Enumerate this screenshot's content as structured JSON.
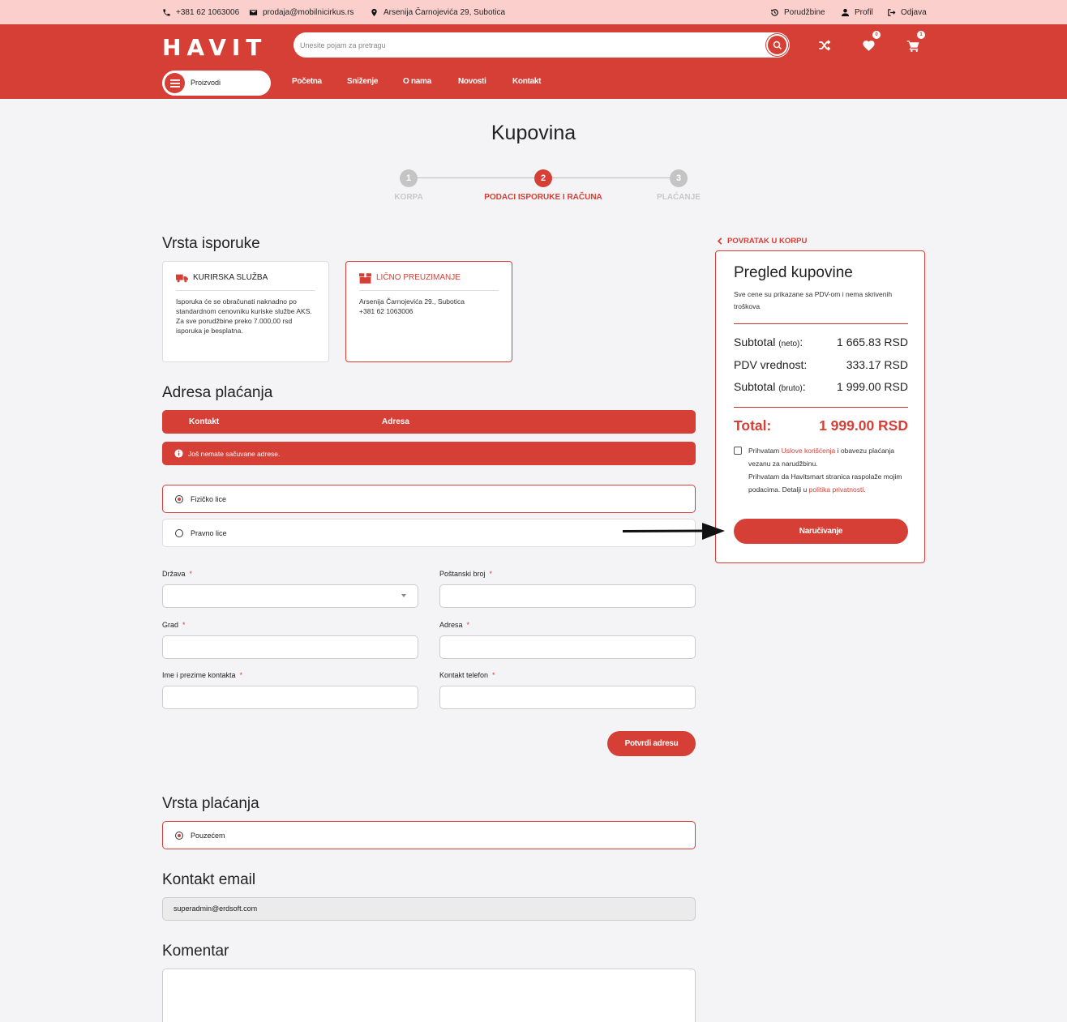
{
  "topbar": {
    "phone": "+381 62 1063006",
    "email": "prodaja@mobilnicirkus.rs",
    "address": "Arsenija Čarnojevića 29, Subotica",
    "orders": "Porudžbine",
    "profile": "Profil",
    "logout": "Odjava"
  },
  "header": {
    "logo": "HAVIT",
    "search_placeholder": "Unesite pojam za pretragu",
    "wishlist_count": "0",
    "cart_count": "1",
    "menu_button": "Proizvodi",
    "nav": [
      "Početna",
      "Sniženje",
      "O nama",
      "Novosti",
      "Kontakt"
    ]
  },
  "page": {
    "title": "Kupovina",
    "steps": [
      {
        "num": "1",
        "label": "KORPA"
      },
      {
        "num": "2",
        "label": "PODACI ISPORUKE I RAČUNA"
      },
      {
        "num": "3",
        "label": "PLAĆANJE"
      }
    ]
  },
  "delivery": {
    "title": "Vrsta isporuke",
    "courier": {
      "title": "KURIRSKA SLUŽBA",
      "text": "Isporuka će se obračunati naknadno po standardnom cenovniku kuriske službe AKS.\nZa sve porudžbine preko 7.000,00 rsd isporuka je besplatna."
    },
    "pickup": {
      "title": "LIČNO PREUZIMANJE",
      "text": "Arsenija Čarnojevića 29., Subotica\n+381 62 1063006"
    }
  },
  "billing": {
    "title": "Adresa plaćanja",
    "tabs": [
      "Kontakt",
      "Adresa"
    ],
    "alert": "Još nemate sačuvane adrese.",
    "person_types": [
      "Fizičko lice",
      "Pravno lice"
    ],
    "fields": {
      "country": "Država",
      "postal": "Poštanski broj",
      "city": "Grad",
      "address": "Adresa",
      "contact_name": "Ime i prezime kontakta",
      "contact_phone": "Kontakt telefon"
    },
    "required_mark": "*",
    "confirm_button": "Potvrdi adresu"
  },
  "payment": {
    "title": "Vrsta plaćanja",
    "option": "Pouzećem"
  },
  "contact_email": {
    "title": "Kontakt email",
    "value": "superadmin@erdsoft.com"
  },
  "comment": {
    "title": "Komentar"
  },
  "summary": {
    "back_link": "POVRATAK U KORPU",
    "title": "Pregled kupovine",
    "note": "Sve cene su prikazane sa PDV-om i nema skrivenih troškova",
    "subtotal_net_label": "Subtotal",
    "subtotal_net_sub": "(neto)",
    "subtotal_net_value": "1 665.83 RSD",
    "vat_label": "PDV vrednost:",
    "vat_value": "333.17 RSD",
    "subtotal_gross_label": "Subtotal",
    "subtotal_gross_sub": "(bruto)",
    "subtotal_gross_value": "1 999.00 RSD",
    "total_label": "Total:",
    "total_value": "1 999.00 RSD",
    "consent_1": "Prihvatam ",
    "consent_link_1": "Uslove korišćenja",
    "consent_2": " i obavezu plaćanja vezanu za narudžbinu.",
    "consent_3": "Prihvatam da Havitsmart stranica raspolaže mojim podacima. Detalji u ",
    "consent_link_2": "politika privatnosti",
    "consent_4": ".",
    "order_button": "Naručivanje"
  },
  "colors": {
    "brand": "#d63f35",
    "topbar": "#fbd0cc",
    "background": "#f4f4f6"
  }
}
